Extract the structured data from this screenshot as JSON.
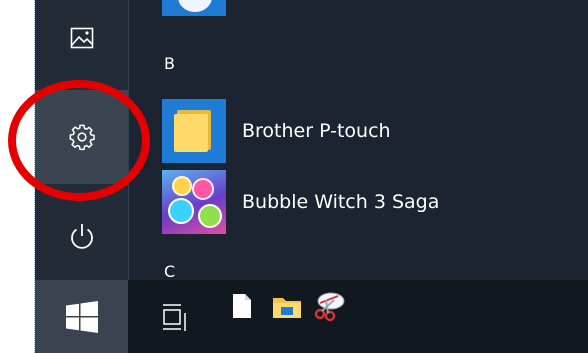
{
  "rail": {
    "pictures_icon": "pictures-icon",
    "settings_icon": "gear-icon",
    "power_icon": "power-icon",
    "start_icon": "windows-logo-icon"
  },
  "app_list": {
    "sections": [
      {
        "letter": "B"
      },
      {
        "letter": "C"
      }
    ],
    "apps": [
      {
        "label": "Brother P-touch",
        "icon": "folder-icon"
      },
      {
        "label": "Bubble Witch 3 Saga",
        "icon": "bubble-witch-icon"
      }
    ]
  },
  "taskbar": {
    "icons": [
      "task-view-icon",
      "file-icon",
      "file-explorer-icon",
      "snipping-tool-icon"
    ]
  },
  "colors": {
    "menu_bg": "#1b2430",
    "rail_bg": "#222b36",
    "settings_hover": "#3b4551",
    "tile_blue": "#1e7bd6",
    "highlight_red": "#e40000"
  }
}
